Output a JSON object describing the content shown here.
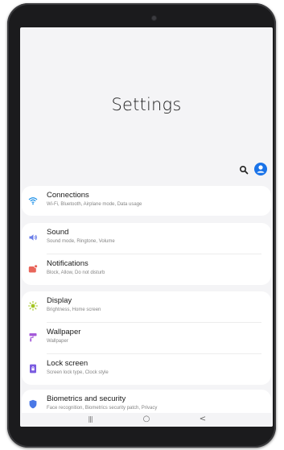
{
  "header": {
    "title": "Settings"
  },
  "toolbar": {
    "search_icon": "search-icon",
    "account_icon": "account-icon"
  },
  "colors": {
    "connections": "#1a8fe8",
    "sound": "#6a7de8",
    "notifications": "#e8655a",
    "display": "#a3c521",
    "wallpaper": "#a45ad9",
    "lockscreen": "#7a5be0",
    "biometrics": "#4a78e6",
    "account": "#1a73e8"
  },
  "items": [
    {
      "label": "Connections",
      "sub": "Wi-Fi, Bluetooth, Airplane mode, Data usage",
      "icon": "wifi-icon"
    },
    {
      "label": "Sound",
      "sub": "Sound mode, Ringtone, Volume",
      "icon": "speaker-icon"
    },
    {
      "label": "Notifications",
      "sub": "Block, Allow, Do not disturb",
      "icon": "notification-icon"
    },
    {
      "label": "Display",
      "sub": "Brightness, Home screen",
      "icon": "sun-icon"
    },
    {
      "label": "Wallpaper",
      "sub": "Wallpaper",
      "icon": "paint-roller-icon"
    },
    {
      "label": "Lock screen",
      "sub": "Screen lock type, Clock style",
      "icon": "lock-screen-icon"
    },
    {
      "label": "Biometrics and security",
      "sub": "Face recognition, Biometrics security patch, Privacy",
      "icon": "shield-icon"
    }
  ],
  "navbar": {
    "recents": "|||",
    "home": "○",
    "back": "<"
  }
}
